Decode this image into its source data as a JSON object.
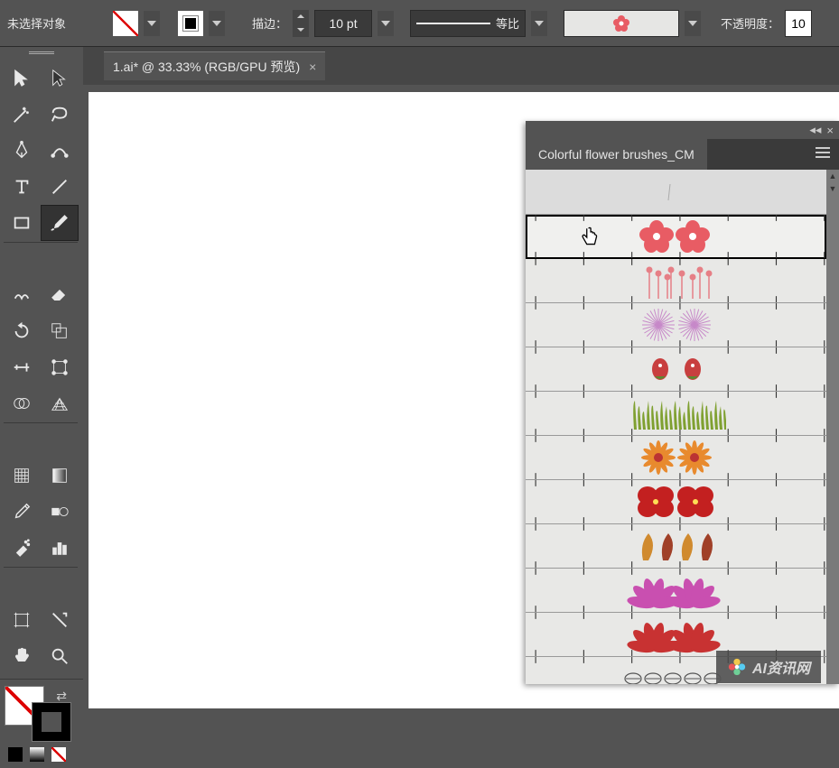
{
  "topbar": {
    "no_selection": "未选择对象",
    "stroke_label": "描边：",
    "stroke_weight": "10 pt",
    "profile_label": "等比",
    "opacity_label": "不透明度：",
    "opacity_value": "10"
  },
  "document": {
    "tab_label": "1.ai* @ 33.33% (RGB/GPU 预览)"
  },
  "tools": [
    "selection-tool",
    "direct-selection-tool",
    "magic-wand-tool",
    "lasso-tool",
    "pen-tool",
    "curvature-tool",
    "type-tool",
    "line-segment-tool",
    "rectangle-tool",
    "paintbrush-tool",
    "shaper-tool",
    "eraser-tool",
    "rotate-tool",
    "scale-tool",
    "width-tool",
    "free-transform-tool",
    "shape-builder-tool",
    "perspective-grid-tool",
    "mesh-tool",
    "gradient-tool",
    "eyedropper-tool",
    "blend-tool",
    "symbol-sprayer-tool",
    "column-graph-tool",
    "artboard-tool",
    "slice-tool",
    "hand-tool",
    "zoom-tool"
  ],
  "brush_panel": {
    "title": "Colorful flower brushes_CM",
    "brushes": [
      {
        "id": "none",
        "kind": "none"
      },
      {
        "id": "pink-flower",
        "kind": "flower",
        "color": "#e85c64",
        "selected": true
      },
      {
        "id": "pink-pins",
        "kind": "pins",
        "color": "#e67f86"
      },
      {
        "id": "purple-burst",
        "kind": "burst",
        "color": "#c789c9"
      },
      {
        "id": "rosebud",
        "kind": "bud",
        "color": "#c83f3f"
      },
      {
        "id": "grass",
        "kind": "grass",
        "color": "#7fa030"
      },
      {
        "id": "orange-daisy",
        "kind": "daisy",
        "color": "#e88a2e"
      },
      {
        "id": "red-4petal",
        "kind": "fourpetal",
        "color": "#c32020"
      },
      {
        "id": "autumn-leaf",
        "kind": "leaf",
        "color": "#d08a2e"
      },
      {
        "id": "magenta-fan",
        "kind": "fan",
        "color": "#c94fb0"
      },
      {
        "id": "red-fan",
        "kind": "fan",
        "color": "#c83232"
      },
      {
        "id": "leaf-outline",
        "kind": "leafline",
        "color": "#555"
      }
    ]
  },
  "watermark": {
    "text": "AI资讯网"
  }
}
